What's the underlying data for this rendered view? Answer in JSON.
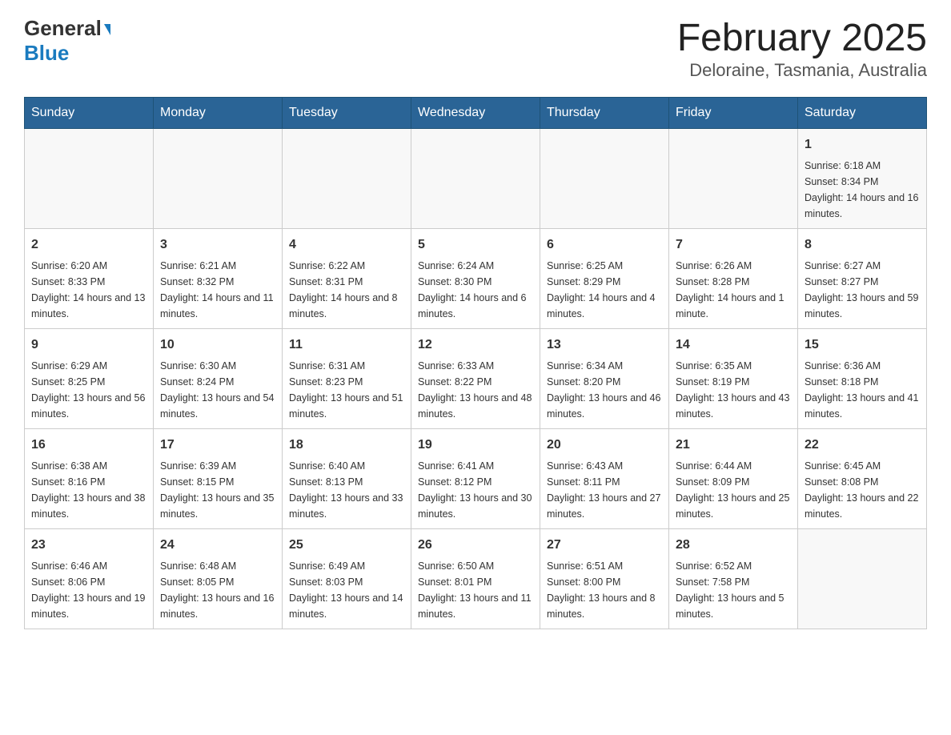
{
  "header": {
    "logo_general": "General",
    "logo_blue": "Blue",
    "title": "February 2025",
    "subtitle": "Deloraine, Tasmania, Australia"
  },
  "days_of_week": [
    "Sunday",
    "Monday",
    "Tuesday",
    "Wednesday",
    "Thursday",
    "Friday",
    "Saturday"
  ],
  "weeks": [
    {
      "days": [
        {
          "num": "",
          "info": ""
        },
        {
          "num": "",
          "info": ""
        },
        {
          "num": "",
          "info": ""
        },
        {
          "num": "",
          "info": ""
        },
        {
          "num": "",
          "info": ""
        },
        {
          "num": "",
          "info": ""
        },
        {
          "num": "1",
          "info": "Sunrise: 6:18 AM\nSunset: 8:34 PM\nDaylight: 14 hours and 16 minutes."
        }
      ]
    },
    {
      "days": [
        {
          "num": "2",
          "info": "Sunrise: 6:20 AM\nSunset: 8:33 PM\nDaylight: 14 hours and 13 minutes."
        },
        {
          "num": "3",
          "info": "Sunrise: 6:21 AM\nSunset: 8:32 PM\nDaylight: 14 hours and 11 minutes."
        },
        {
          "num": "4",
          "info": "Sunrise: 6:22 AM\nSunset: 8:31 PM\nDaylight: 14 hours and 8 minutes."
        },
        {
          "num": "5",
          "info": "Sunrise: 6:24 AM\nSunset: 8:30 PM\nDaylight: 14 hours and 6 minutes."
        },
        {
          "num": "6",
          "info": "Sunrise: 6:25 AM\nSunset: 8:29 PM\nDaylight: 14 hours and 4 minutes."
        },
        {
          "num": "7",
          "info": "Sunrise: 6:26 AM\nSunset: 8:28 PM\nDaylight: 14 hours and 1 minute."
        },
        {
          "num": "8",
          "info": "Sunrise: 6:27 AM\nSunset: 8:27 PM\nDaylight: 13 hours and 59 minutes."
        }
      ]
    },
    {
      "days": [
        {
          "num": "9",
          "info": "Sunrise: 6:29 AM\nSunset: 8:25 PM\nDaylight: 13 hours and 56 minutes."
        },
        {
          "num": "10",
          "info": "Sunrise: 6:30 AM\nSunset: 8:24 PM\nDaylight: 13 hours and 54 minutes."
        },
        {
          "num": "11",
          "info": "Sunrise: 6:31 AM\nSunset: 8:23 PM\nDaylight: 13 hours and 51 minutes."
        },
        {
          "num": "12",
          "info": "Sunrise: 6:33 AM\nSunset: 8:22 PM\nDaylight: 13 hours and 48 minutes."
        },
        {
          "num": "13",
          "info": "Sunrise: 6:34 AM\nSunset: 8:20 PM\nDaylight: 13 hours and 46 minutes."
        },
        {
          "num": "14",
          "info": "Sunrise: 6:35 AM\nSunset: 8:19 PM\nDaylight: 13 hours and 43 minutes."
        },
        {
          "num": "15",
          "info": "Sunrise: 6:36 AM\nSunset: 8:18 PM\nDaylight: 13 hours and 41 minutes."
        }
      ]
    },
    {
      "days": [
        {
          "num": "16",
          "info": "Sunrise: 6:38 AM\nSunset: 8:16 PM\nDaylight: 13 hours and 38 minutes."
        },
        {
          "num": "17",
          "info": "Sunrise: 6:39 AM\nSunset: 8:15 PM\nDaylight: 13 hours and 35 minutes."
        },
        {
          "num": "18",
          "info": "Sunrise: 6:40 AM\nSunset: 8:13 PM\nDaylight: 13 hours and 33 minutes."
        },
        {
          "num": "19",
          "info": "Sunrise: 6:41 AM\nSunset: 8:12 PM\nDaylight: 13 hours and 30 minutes."
        },
        {
          "num": "20",
          "info": "Sunrise: 6:43 AM\nSunset: 8:11 PM\nDaylight: 13 hours and 27 minutes."
        },
        {
          "num": "21",
          "info": "Sunrise: 6:44 AM\nSunset: 8:09 PM\nDaylight: 13 hours and 25 minutes."
        },
        {
          "num": "22",
          "info": "Sunrise: 6:45 AM\nSunset: 8:08 PM\nDaylight: 13 hours and 22 minutes."
        }
      ]
    },
    {
      "days": [
        {
          "num": "23",
          "info": "Sunrise: 6:46 AM\nSunset: 8:06 PM\nDaylight: 13 hours and 19 minutes."
        },
        {
          "num": "24",
          "info": "Sunrise: 6:48 AM\nSunset: 8:05 PM\nDaylight: 13 hours and 16 minutes."
        },
        {
          "num": "25",
          "info": "Sunrise: 6:49 AM\nSunset: 8:03 PM\nDaylight: 13 hours and 14 minutes."
        },
        {
          "num": "26",
          "info": "Sunrise: 6:50 AM\nSunset: 8:01 PM\nDaylight: 13 hours and 11 minutes."
        },
        {
          "num": "27",
          "info": "Sunrise: 6:51 AM\nSunset: 8:00 PM\nDaylight: 13 hours and 8 minutes."
        },
        {
          "num": "28",
          "info": "Sunrise: 6:52 AM\nSunset: 7:58 PM\nDaylight: 13 hours and 5 minutes."
        },
        {
          "num": "",
          "info": ""
        }
      ]
    }
  ]
}
